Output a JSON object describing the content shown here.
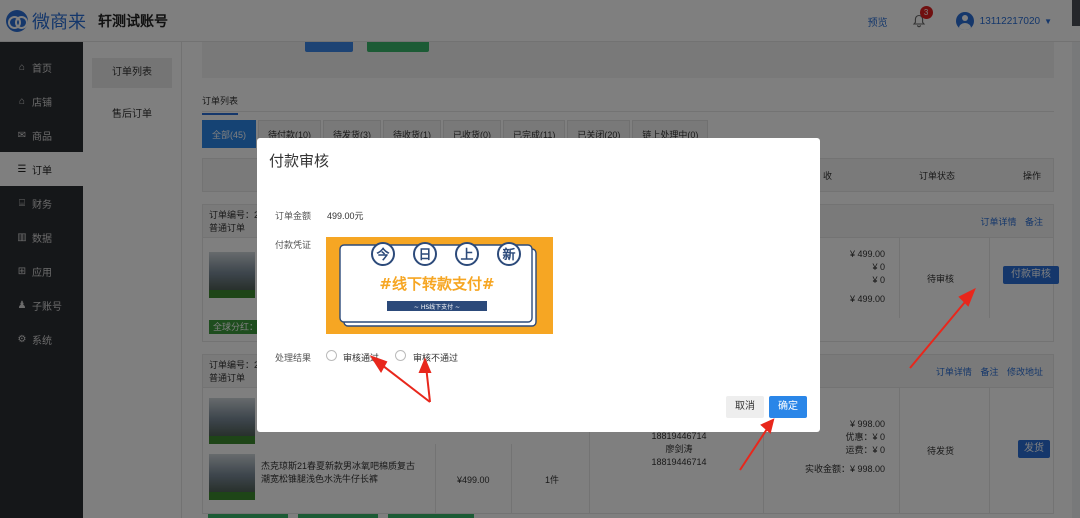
{
  "header": {
    "brand": "微商来",
    "store_name": "轩测试账号",
    "preview": "预览",
    "notification_count": "3",
    "user_phone": "13112217020"
  },
  "sidebar": {
    "items": [
      {
        "icon": "⌂",
        "label": "首页"
      },
      {
        "icon": "⌂",
        "label": "店铺"
      },
      {
        "icon": "✉",
        "label": "商品"
      },
      {
        "icon": "☰",
        "label": "订单"
      },
      {
        "icon": "⌸",
        "label": "财务"
      },
      {
        "icon": "▥",
        "label": "数据"
      },
      {
        "icon": "⊞",
        "label": "应用"
      },
      {
        "icon": "♟",
        "label": "子账号"
      },
      {
        "icon": "⚙",
        "label": "系统"
      }
    ]
  },
  "subnav": {
    "items": [
      "订单列表",
      "售后订单"
    ]
  },
  "main": {
    "section_tab": "订单列表",
    "tabs": [
      "全部(45)",
      "待付款(10)",
      "待发货(3)",
      "待收货(1)",
      "已收货(0)",
      "已完成(11)",
      "已关闭(20)",
      "链上处理中(0)"
    ],
    "columns": {
      "receive": "收",
      "status": "订单状态",
      "ops": "操作"
    },
    "order1": {
      "no_label": "订单编号：2",
      "type": "普通订单",
      "links": [
        "订单详情",
        "备注"
      ],
      "prices": [
        "¥ 499.00",
        "¥ 0",
        "¥ 0",
        "¥ 499.00"
      ],
      "status": "待审核",
      "action": "付款审核",
      "tag": "全球分红："
    },
    "order2": {
      "no_label": "订单编号：2",
      "type": "普通订单",
      "links": [
        "订单详情",
        "备注",
        "修改地址"
      ],
      "phones": [
        "18819446714",
        "廖剑涛",
        "18819446714"
      ],
      "product_name": "杰克琼斯21春夏新款男冰氧吧棉质复古潮宽松锥腿浅色水洗牛仔长裤",
      "unit_price": "¥499.00",
      "qty": "1件",
      "amount": "¥ 998.00",
      "discount": "优惠：¥ 0",
      "shipping": "运费：¥ 0",
      "paid": "实收金额：¥ 998.00",
      "status": "待发货",
      "action": "发货"
    }
  },
  "modal": {
    "title": "付款审核",
    "amount_label": "订单金额",
    "amount_value": "499.00元",
    "voucher_label": "付款凭证",
    "voucher": {
      "chars": [
        "今",
        "日",
        "上",
        "新"
      ],
      "headline": "#线下转款支付#",
      "subline": "~ HS线下支付 ~"
    },
    "result_label": "处理结果",
    "options": [
      "审核通过",
      "审核不通过"
    ],
    "cancel": "取消",
    "confirm": "确定"
  }
}
